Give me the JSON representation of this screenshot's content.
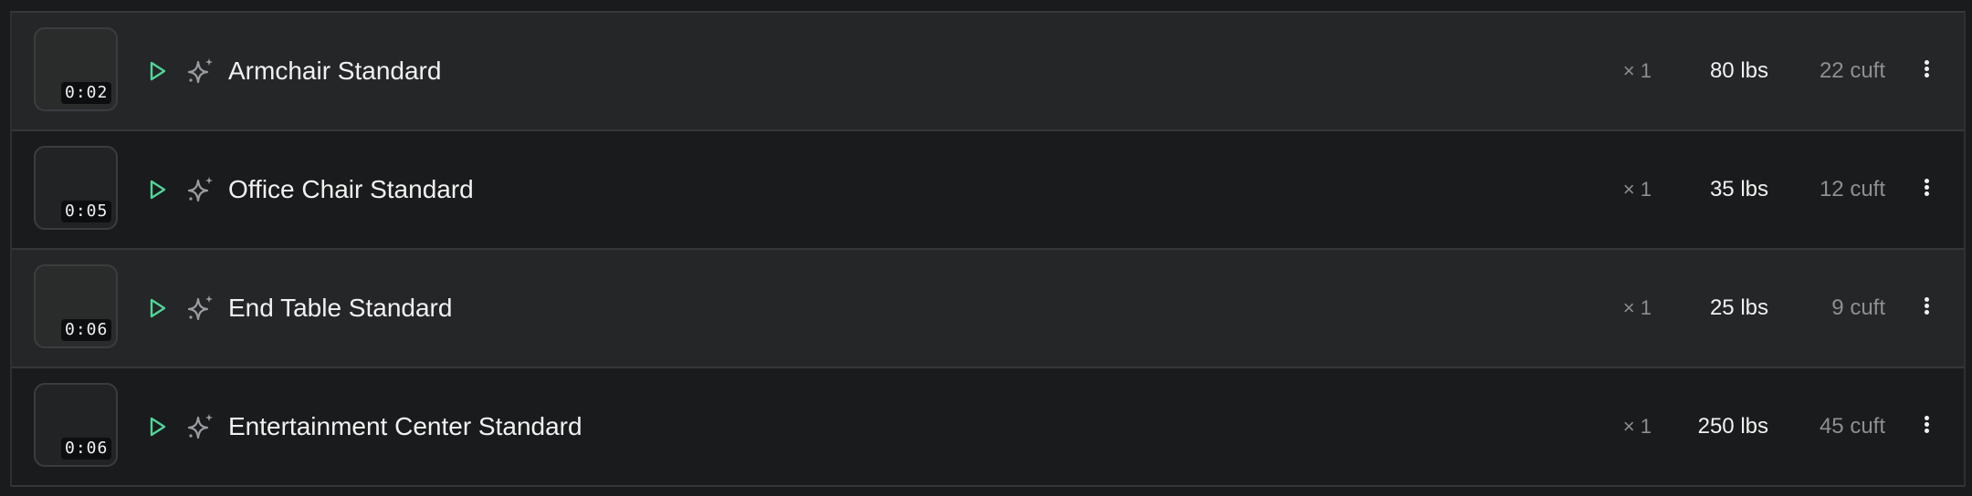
{
  "items": [
    {
      "name": "Armchair Standard",
      "duration": "0:02",
      "qty": "× 1",
      "weight": "80 lbs",
      "volume": "22 cuft"
    },
    {
      "name": "Office Chair Standard",
      "duration": "0:05",
      "qty": "× 1",
      "weight": "35 lbs",
      "volume": "12 cuft"
    },
    {
      "name": "End Table Standard",
      "duration": "0:06",
      "qty": "× 1",
      "weight": "25 lbs",
      "volume": "9 cuft"
    },
    {
      "name": "Entertainment Center Standard",
      "duration": "0:06",
      "qty": "× 1",
      "weight": "250 lbs",
      "volume": "45 cuft"
    }
  ],
  "colors": {
    "play_accent": "#4fd69a",
    "sparkle": "#9a9ca0",
    "row_alt": "#252628",
    "row_base": "#1a1b1c"
  }
}
